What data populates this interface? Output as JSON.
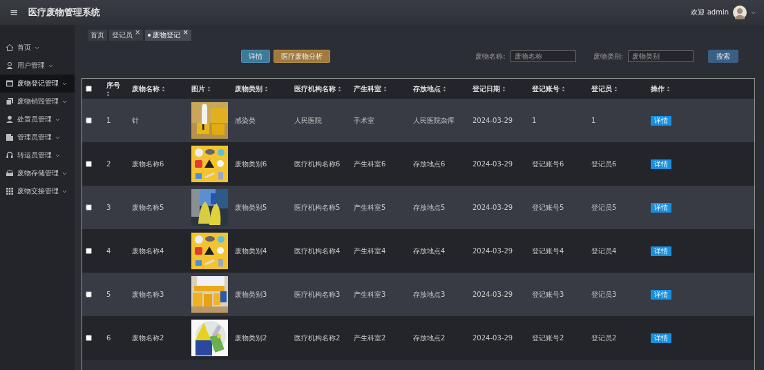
{
  "header": {
    "menu_icon": "≡",
    "title": "医疗废物管理系统",
    "welcome": "欢迎 admin"
  },
  "sidebar": {
    "items": [
      {
        "label": "首页",
        "selected": false
      },
      {
        "label": "用户管理",
        "selected": false
      },
      {
        "label": "废物登记管理",
        "selected": true
      },
      {
        "label": "废物销毁管理",
        "selected": false
      },
      {
        "label": "处置员管理",
        "selected": false
      },
      {
        "label": "管理员管理",
        "selected": false
      },
      {
        "label": "转运员管理",
        "selected": false
      },
      {
        "label": "废物存储管理",
        "selected": false
      },
      {
        "label": "废物交接管理",
        "selected": false
      }
    ]
  },
  "tabs": [
    {
      "label": "首页",
      "selected": false
    },
    {
      "label": "登记员",
      "close": "×",
      "selected": false
    },
    {
      "label": "废物登记",
      "close": "×",
      "selected": true
    }
  ],
  "toolbar": {
    "buttons": [
      {
        "label": "详情",
        "kind": "info"
      },
      {
        "label": "医疗废物分析",
        "kind": "warning"
      }
    ],
    "filters": [
      {
        "label": "废物名称:",
        "placeholder": "废物名称"
      },
      {
        "label": "废物类别:",
        "placeholder": "废物类别"
      }
    ],
    "search_button": "搜索"
  },
  "table": {
    "select_all_checked": false,
    "columns": [
      "序号",
      "废物名称",
      "图片",
      "废物类别",
      "医疗机构名称",
      "产生科室",
      "存放地点",
      "登记日期",
      "登记账号",
      "登记员",
      "操作"
    ],
    "rows": [
      {
        "checked": false,
        "cells": [
          "1",
          "针",
          "",
          "感染类",
          "人民医院",
          "手术室",
          "人民医院杂库",
          "2024-03-29",
          "1",
          "1",
          "详情"
        ]
      },
      {
        "checked": false,
        "cells": [
          "2",
          "废物名称6",
          "",
          "废物类别6",
          "医疗机构名称6",
          "产生科室6",
          "存放地点6",
          "2024-03-29",
          "登记账号6",
          "登记员6",
          "详情"
        ]
      },
      {
        "checked": false,
        "cells": [
          "3",
          "废物名称5",
          "",
          "废物类别5",
          "医疗机构名称5",
          "产生科室5",
          "存放地点5",
          "2024-03-29",
          "登记账号5",
          "登记员5",
          "详情"
        ]
      },
      {
        "checked": false,
        "cells": [
          "4",
          "废物名称4",
          "",
          "废物类别4",
          "医疗机构名称4",
          "产生科室4",
          "存放地点4",
          "2024-03-29",
          "登记账号4",
          "登记员4",
          "详情"
        ]
      },
      {
        "checked": false,
        "cells": [
          "5",
          "废物名称3",
          "",
          "废物类别3",
          "医疗机构名称3",
          "产生科室3",
          "存放地点3",
          "2024-03-29",
          "登记账号3",
          "登记员3",
          "详情"
        ]
      },
      {
        "checked": false,
        "cells": [
          "6",
          "废物名称2",
          "",
          "废物类别2",
          "医疗机构名称2",
          "产生科室2",
          "存放地点2",
          "2024-03-29",
          "登记账号2",
          "登记员2",
          "详情"
        ]
      }
    ]
  }
}
